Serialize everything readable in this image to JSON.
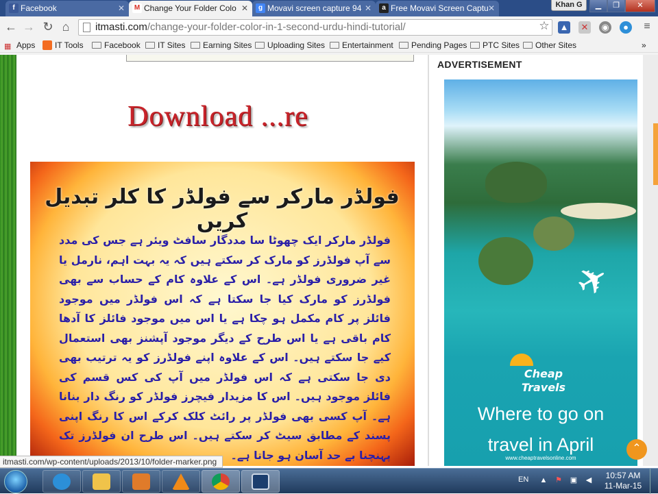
{
  "browser": {
    "tabs": [
      {
        "label": "Facebook",
        "icon": "facebook-icon",
        "active": false
      },
      {
        "label": "Change Your Folder Colo",
        "icon": "gmail-icon",
        "active": true
      },
      {
        "label": "Movavi screen capture 94",
        "icon": "google-icon",
        "active": false
      },
      {
        "label": "Free Movavi Screen Captu",
        "icon": "amazon-icon",
        "active": false
      }
    ],
    "profile": "Khan G",
    "url_host": "itmasti.com",
    "url_path": "/change-your-folder-color-in-1-second-urdu-hindi-tutorial/",
    "bookmarks": [
      "Apps",
      "IT Tools",
      "Facebook",
      "IT Sites",
      "Earning Sites",
      "Uploading Sites",
      "Entertainment",
      "Pending Pages",
      "PTC Sites",
      "Other Sites"
    ],
    "more": "»"
  },
  "page": {
    "download_text": "Download ...re",
    "urdu_title": "فولڈر مارکر سے فولڈر کا کلر تبدیل کریں",
    "urdu_body": "فولڈر مارکر ایک چھوٹا سا مددگار سافٹ ویئر ہے جس کی مدد سے آپ فولڈرز کو مارک کر سکتے ہیں کہ یہ بہت اہم، نارمل یا غیر ضروری فولڈر ہے۔ اس کے علاوہ کام کے حساب سے بھی فولڈرز کو مارک کیا جا سکتا ہے کہ اس فولڈر میں موجود فائلز پر کام مکمل ہو چکا ہے یا اس میں موجود فائلز کا آدھا کام باقی ہے یا اس طرح کے دیگر موجود آپشنز بھی استعمال کیے جا سکتے ہیں۔ اس کے علاوہ اپنے فولڈرز کو یہ ترتیب بھی دی جا سکتی ہے کہ اس فولڈر میں آپ کی کس قسم کی فائلز موجود ہیں۔ اس کا مزیدار فیچرز فولڈر کو رنگ دار بنانا ہے۔ آپ کسی بھی فولڈر پر رائٹ کلک کرکے اس کا رنگ اپنی پسند کے مطابق سیٹ کر سکتے ہیں۔ اس طرح ان فولڈرز تک پہنچنا بے حد آسان ہو جاتا ہے۔"
  },
  "sidebar": {
    "heading": "ADVERTISEMENT",
    "ad_brand": "Cheap Travels",
    "ad_tagline_1": "Where to go on",
    "ad_tagline_2": "travel in April",
    "ad_url": "www.cheaptravelsonline.com"
  },
  "status_bar": "itmasti.com/wp-content/uploads/2013/10/folder-marker.png",
  "taskbar": {
    "language": "EN",
    "time": "10:57 AM",
    "date": "11-Mar-15"
  },
  "colors": {
    "grass": "#3a8f24",
    "accent_orange": "#f0961e",
    "urdu_text": "#2a1fa8",
    "download_red": "#c8232a"
  }
}
